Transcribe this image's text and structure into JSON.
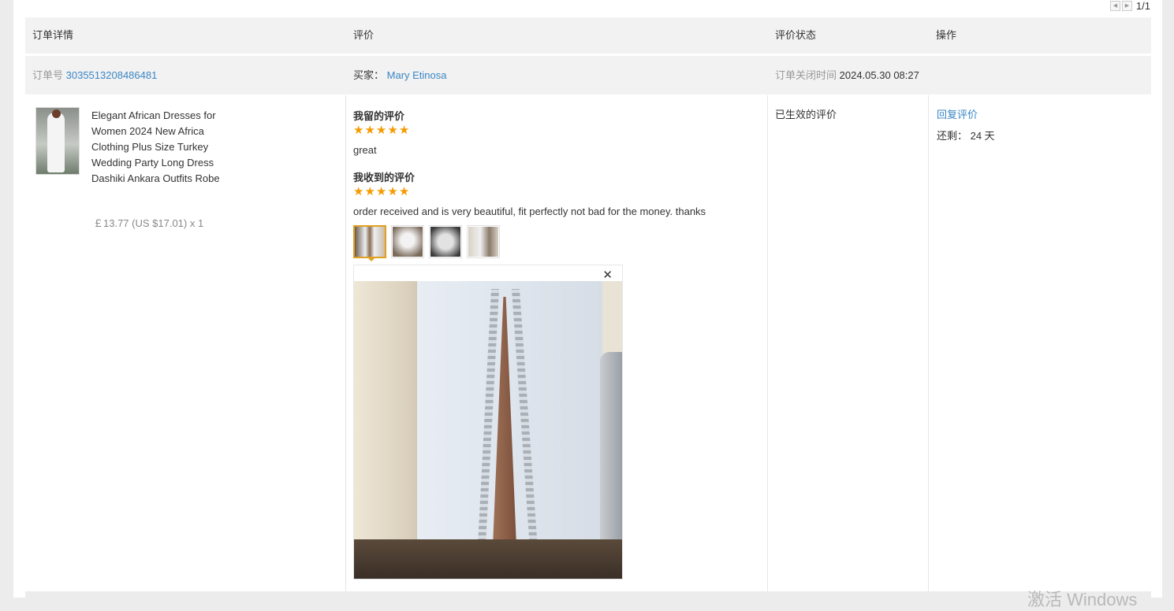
{
  "pager": {
    "prev_icon": "chevron-left-icon",
    "next_icon": "chevron-right-icon",
    "text": "1/1"
  },
  "table": {
    "headers": {
      "order_details": "订单详情",
      "review": "评价",
      "review_status": "评价状态",
      "actions": "操作"
    }
  },
  "order": {
    "order_no_label": "订单号",
    "order_no": "3035513208486481",
    "buyer_label": "买家：",
    "buyer": "Mary Etinosa",
    "closed_label": "订单关闭时间",
    "closed_time": "2024.05.30 08:27"
  },
  "product": {
    "title": "Elegant African Dresses for Women 2024 New Africa Clothing Plus Size Turkey Wedding Party Long Dress Dashiki Ankara Outfits Robe",
    "price": "￡13.77 (US $17.01) x 1"
  },
  "review": {
    "my_review_label": "我留的评价",
    "my_rating": 5,
    "my_text": "great",
    "received_label": "我收到的评价",
    "received_rating": 5,
    "received_text": "order received and is very beautiful, fit perfectly not bad for the money. thanks",
    "photos_count": 4,
    "active_photo": 1,
    "star_color": "#f59b00"
  },
  "status": {
    "text": "已生效的评价"
  },
  "actions": {
    "reply": "回复评价",
    "remaining": "还剩： 24 天"
  },
  "watermark": "激活 Windows",
  "colors": {
    "link": "#3a86c4",
    "header_bg": "#f2f2f2",
    "active_border": "#e0a020"
  }
}
